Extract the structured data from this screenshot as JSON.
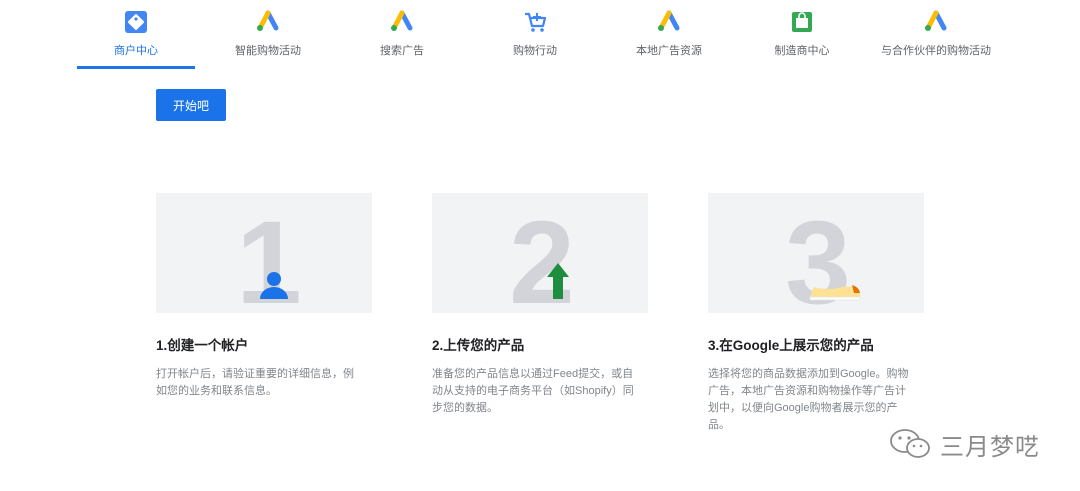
{
  "nav": {
    "items": [
      {
        "label": "商户中心",
        "icon": "merchant-tag-icon",
        "active": true
      },
      {
        "label": "智能购物活动",
        "icon": "google-ads-logo-icon",
        "active": false
      },
      {
        "label": "搜索广告",
        "icon": "google-ads-logo-icon",
        "active": false
      },
      {
        "label": "购物行动",
        "icon": "shopping-cart-icon",
        "active": false
      },
      {
        "label": "本地广告资源",
        "icon": "google-ads-logo-icon",
        "active": false
      },
      {
        "label": "制造商中心",
        "icon": "manufacturer-bag-icon",
        "active": false
      },
      {
        "label": "与合作伙伴的购物活动",
        "icon": "google-ads-logo-icon",
        "active": false
      }
    ]
  },
  "cta_label": "开始吧",
  "steps": [
    {
      "numeral": "1",
      "title": "1.创建一个帐户",
      "desc_line1": "打开帐户后，请验证重要的详细信息，例",
      "desc_line2": "如您的业务和联系信息。",
      "icon": "person-icon"
    },
    {
      "numeral": "2",
      "title": "2.上传您的产品",
      "desc_line1": "准备您的产品信息以通过Feed提交，或自",
      "desc_line2": "动从支持的电子商务平台（如Shopify）同",
      "desc_line3": "步您的数据。",
      "icon": "upload-arrow-icon"
    },
    {
      "numeral": "3",
      "title": "3.在Google上展示您的产品",
      "desc_line1": "选择将您的商品数据添加到Google。购物",
      "desc_line2": "广告，本地广告资源和购物操作等广告计",
      "desc_line3": "划中，以便向Google购物者展示您的产",
      "desc_line4": "品。",
      "icon": "shoe-icon"
    }
  ],
  "watermark": {
    "text": "三月梦呓",
    "icon": "wechat-icon"
  },
  "colors": {
    "accent": "#1a73e8",
    "card_bg": "#f1f3f4",
    "numeral": "#d2d4da",
    "green": "#1e8e3e",
    "yellow": "#fbbc04",
    "orange": "#e37400"
  }
}
